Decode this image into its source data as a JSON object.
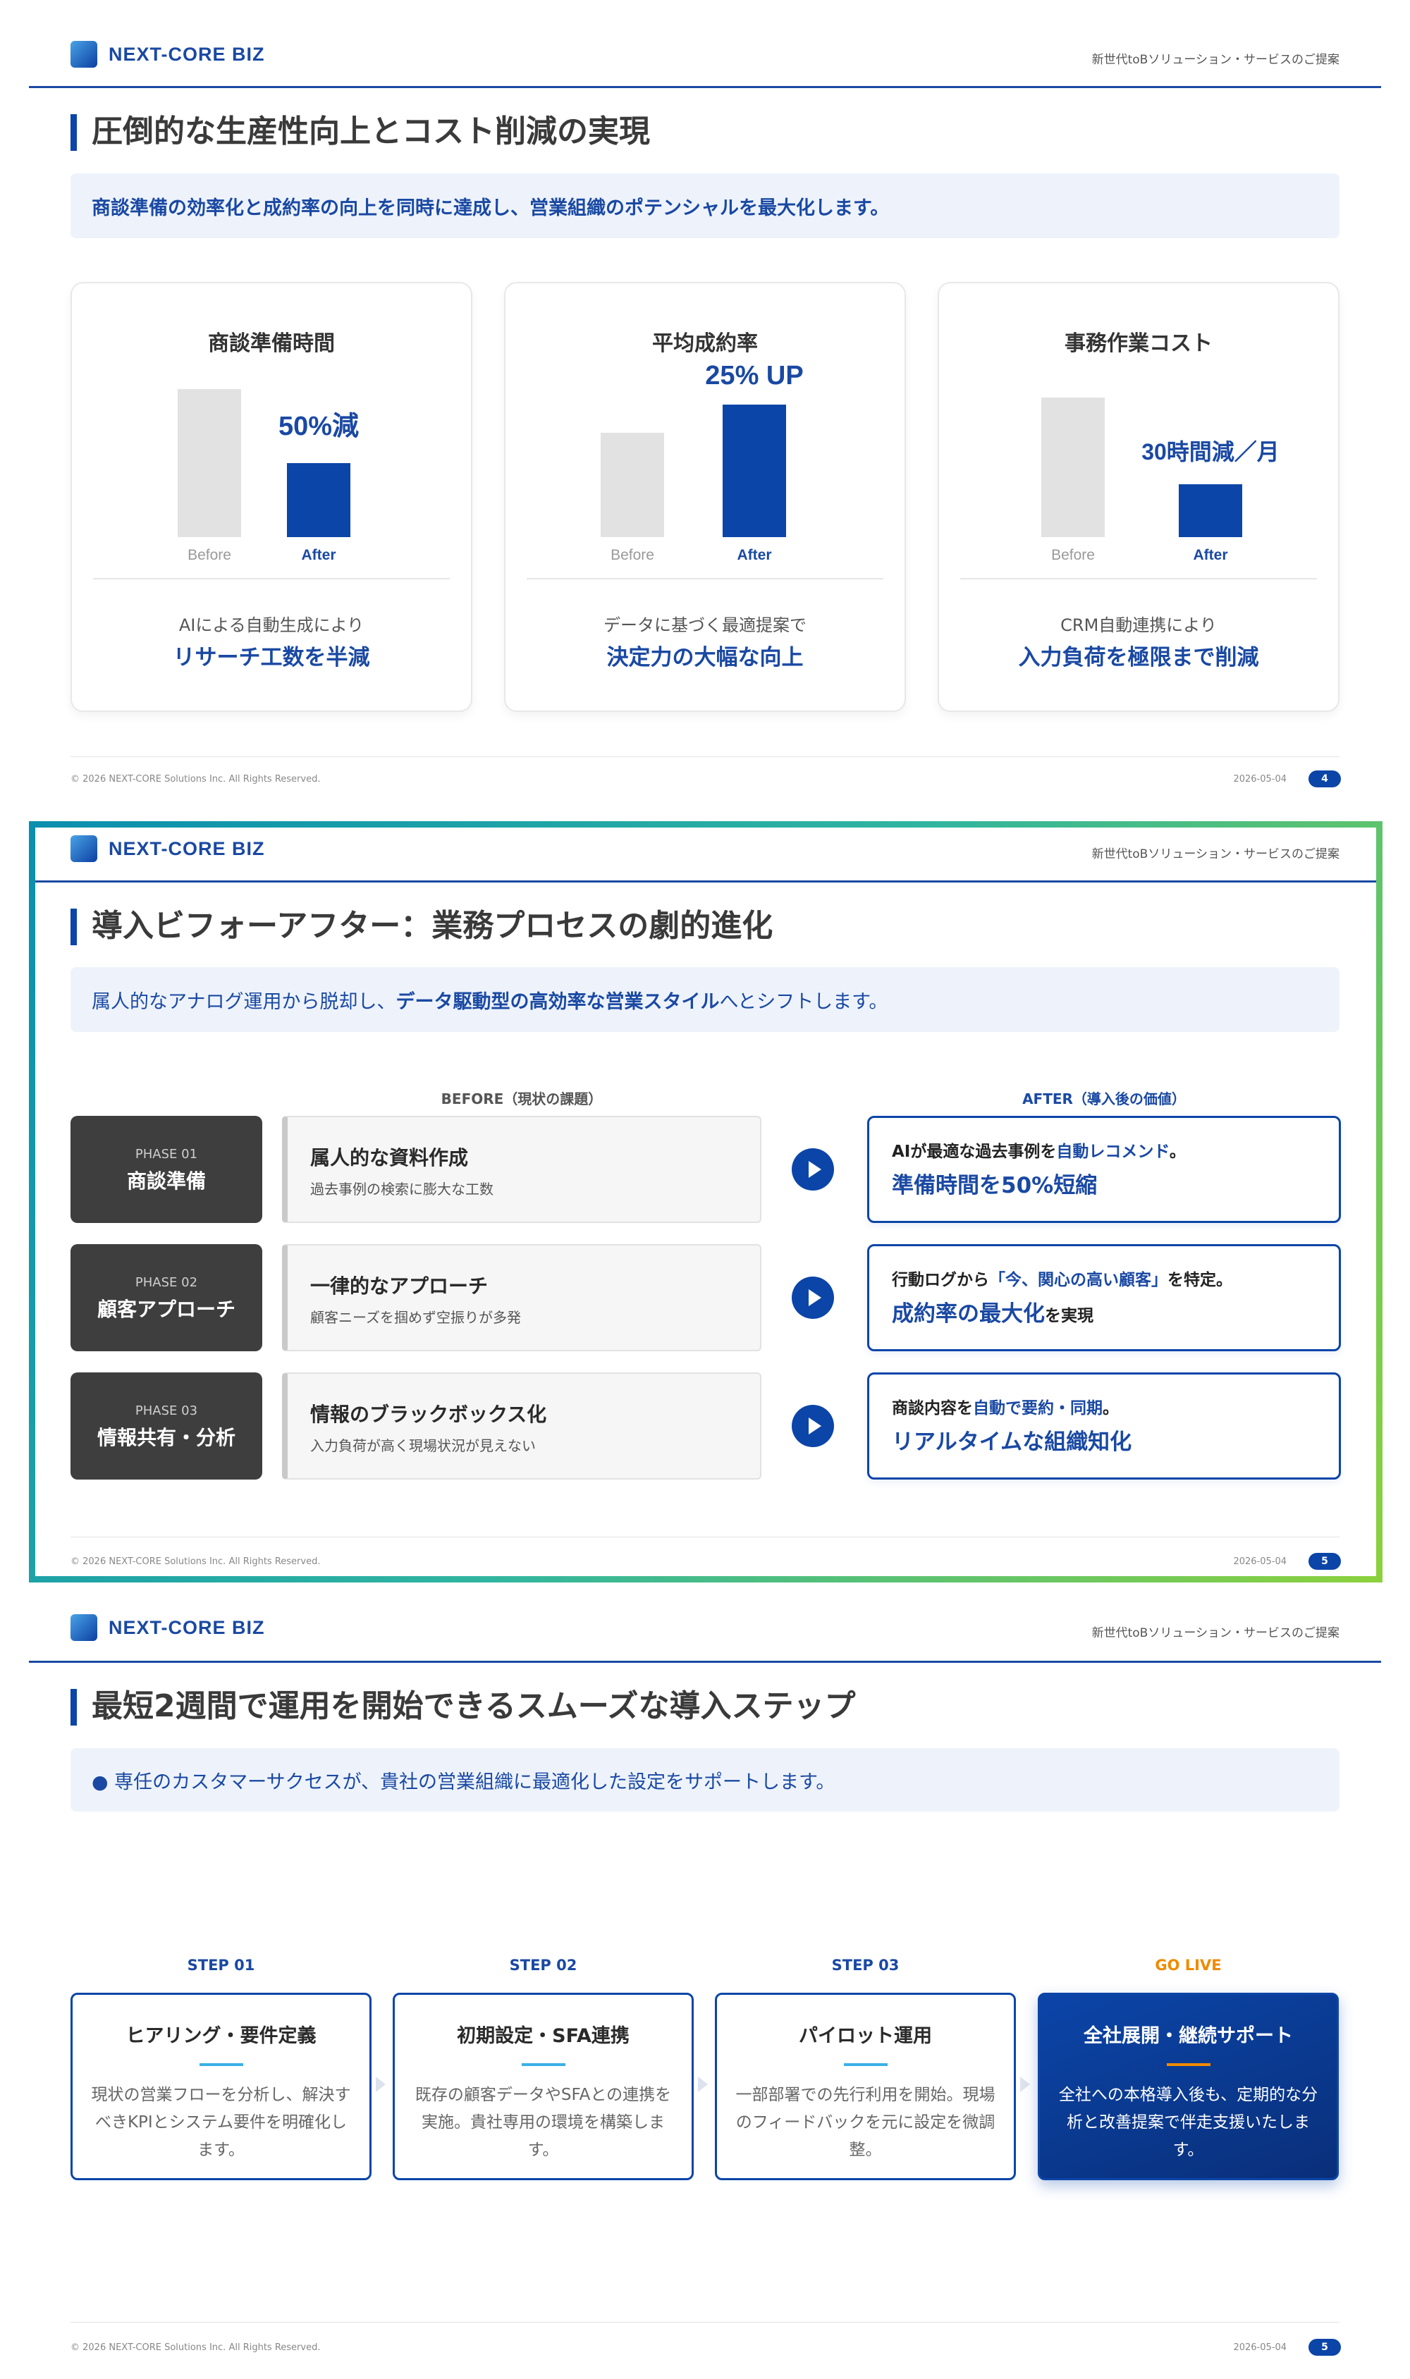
{
  "header": {
    "brand": "NEXT-CORE BIZ",
    "tagline": "新世代toBソリューション・サービスのご提案"
  },
  "footer": {
    "copyright": "© 2026 NEXT-CORE Solutions Inc. All Rights Reserved.",
    "date": "2026-05-04"
  },
  "colors": {
    "primary": "#0b45a8",
    "accent_line": "#3ab0e6",
    "go_live": "#f08a00",
    "before_bar": "#e2e2e2",
    "highlight_frame": "#2aa37f"
  },
  "slide1": {
    "title": "圧倒的な生産性向上とコスト削減の実現",
    "subtitle": "商談準備の効率化と成約率の向上を同時に達成し、営業組織のポテンシャルを最大化します。",
    "page": "4",
    "cards": [
      {
        "title": "商談準備時間",
        "badge": "50%減",
        "before_label": "Before",
        "after_label": "After",
        "desc": "AIによる自動生成により",
        "highlight": "リサーチ工数を半減"
      },
      {
        "title": "平均成約率",
        "badge": "25% UP",
        "before_label": "Before",
        "after_label": "After",
        "desc": "データに基づく最適提案で",
        "highlight": "決定力の大幅な向上"
      },
      {
        "title": "事務作業コスト",
        "badge": "30時間減／月",
        "before_label": "Before",
        "after_label": "After",
        "desc": "CRM自動連携により",
        "highlight": "入力負荷を極限まで削減"
      }
    ]
  },
  "slide2": {
    "title": "導入ビフォーアフター：業務プロセスの劇的進化",
    "subtitle_pre": "属人的なアナログ運用から脱却し、",
    "subtitle_em": "データ駆動型の高効率な営業スタイル",
    "subtitle_post": "へとシフトします。",
    "before_header": "BEFORE（現状の課題）",
    "after_header": "AFTER（導入後の価値）",
    "page": "5",
    "rows": [
      {
        "phase": "PHASE 01",
        "name": "商談準備",
        "before_title": "属人的な資料作成",
        "before_desc": "過去事例の検索に膨大な工数",
        "after_t1": "AIが最適な過去事例を",
        "after_t2": "自動レコメンド",
        "after_t3": "。",
        "after_h1": "準備時間を50%短縮",
        "after_h2": ""
      },
      {
        "phase": "PHASE 02",
        "name": "顧客アプローチ",
        "before_title": "一律的なアプローチ",
        "before_desc": "顧客ニーズを掴めず空振りが多発",
        "after_t1": "行動ログから",
        "after_t2": "「今、関心の高い顧客」",
        "after_t3": "を特定。",
        "after_h1": "成約率の最大化",
        "after_h2": "を実現"
      },
      {
        "phase": "PHASE 03",
        "name": "情報共有・分析",
        "before_title": "情報のブラックボックス化",
        "before_desc": "入力負荷が高く現場状況が見えない",
        "after_t1": "商談内容を",
        "after_t2": "自動で要約・同期",
        "after_t3": "。",
        "after_h1": "リアルタイムな組織知化",
        "after_h2": ""
      }
    ]
  },
  "slide3": {
    "title": "最短2週間で運用を開始できるスムーズな導入ステップ",
    "subtitle": "● 専任のカスタマーサクセスが、貴社の営業組織に最適化した設定をサポートします。",
    "page": "5",
    "steps": [
      {
        "label": "STEP 01",
        "title": "ヒアリング・要件定義",
        "desc": "現状の営業フローを分析し、解決すべきKPIとシステム要件を明確化します。"
      },
      {
        "label": "STEP 02",
        "title": "初期設定・SFA連携",
        "desc": "既存の顧客データやSFAとの連携を実施。貴社専用の環境を構築します。"
      },
      {
        "label": "STEP 03",
        "title": "パイロット運用",
        "desc": "一部部署での先行利用を開始。現場のフィードバックを元に設定を微調整。"
      },
      {
        "label": "GO LIVE",
        "title": "全社展開・継続サポート",
        "desc": "全社への本格導入後も、定期的な分析と改善提案で伴走支援いたします。"
      }
    ]
  }
}
